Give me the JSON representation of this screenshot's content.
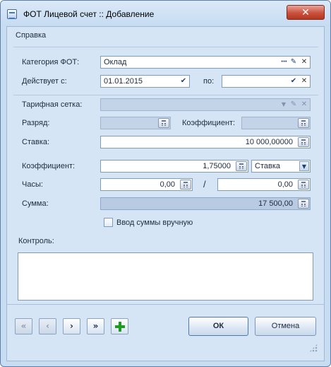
{
  "window": {
    "title": "ФОТ Лицевой счет :: Добавление",
    "close_glyph": "✕"
  },
  "menu": {
    "help_label": "Справка"
  },
  "form": {
    "category": {
      "label": "Категория ФОТ:",
      "value": "Оклад"
    },
    "valid_from": {
      "label": "Действует с:",
      "value": "01.01.2015"
    },
    "valid_to": {
      "label": "по:",
      "value": ""
    },
    "tariff_grid": {
      "label": "Тарифная сетка:",
      "value": ""
    },
    "grade": {
      "label": "Разряд:",
      "value": ""
    },
    "grade_coef": {
      "label": "Коэффициент:",
      "value": ""
    },
    "rate": {
      "label": "Ставка:",
      "value": "10 000,00000"
    },
    "coefficient": {
      "label": "Коэффициент:",
      "value": "1,75000",
      "mode": "Ставка"
    },
    "hours": {
      "label": "Часы:",
      "value1": "0,00",
      "separator": "/",
      "value2": "0,00"
    },
    "sum": {
      "label": "Сумма:",
      "value": "17 500,00"
    },
    "manual_sum": {
      "label": "Ввод суммы вручную",
      "checked": false
    },
    "control": {
      "label": "Контроль:",
      "value": ""
    }
  },
  "icons": {
    "ellipsis": "···",
    "check": "✔",
    "clear": "✕",
    "dropdown": "▼",
    "edit": "✎"
  },
  "nav": {
    "first": "«",
    "prev": "‹",
    "next": "›",
    "last": "»"
  },
  "buttons": {
    "ok": "ОК",
    "cancel": "Отмена"
  },
  "colors": {
    "accent": "#1e9b22",
    "close": "#c9513e"
  }
}
